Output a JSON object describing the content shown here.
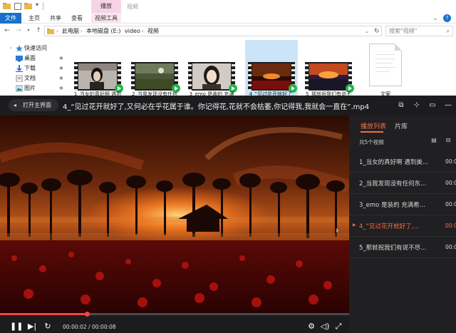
{
  "explorer": {
    "ribbon_context_tab": "播放",
    "window_title": "视频",
    "tabs": {
      "file": "文件",
      "home": "主页",
      "share": "共享",
      "view": "查看",
      "video_tools": "视频工具"
    },
    "breadcrumb": [
      "此电脑",
      "本地磁盘 (E:)",
      "video",
      "视频"
    ],
    "search_placeholder": "搜索\"视频\"",
    "nav_items": [
      {
        "label": "快速访问",
        "icon": "star-icon"
      },
      {
        "label": "桌面",
        "icon": "desktop-icon"
      },
      {
        "label": "下载",
        "icon": "download-icon"
      },
      {
        "label": "文档",
        "icon": "document-icon"
      },
      {
        "label": "图片",
        "icon": "picture-icon"
      }
    ],
    "files": [
      {
        "label": "1_当女的真好啊 遇到",
        "type": "video"
      },
      {
        "label": "2_当我发现没有任何",
        "type": "video"
      },
      {
        "label": "3_emo 是装的 充满",
        "type": "video"
      },
      {
        "label": "4_\"见过花开就好了,",
        "type": "video",
        "selected": true
      },
      {
        "label": "5_那就祝我们有说不",
        "type": "video"
      },
      {
        "label": "文案",
        "type": "text"
      }
    ]
  },
  "player": {
    "home_button": "打开主界面",
    "title": "4_“见过花开就好了,又何必在乎花属于谁。你记得花,花就不会枯萎,你记得我,我就会一直在”.mp4",
    "tabs": {
      "playlist": "播放列表",
      "library": "片库"
    },
    "count_text": "共5个视频",
    "items": [
      {
        "title": "1_当女的真好啊 遇到美...",
        "duration": "00:0"
      },
      {
        "title": "2_当我发现没有任何东...",
        "duration": "00:0"
      },
      {
        "title": "3_emo 是装的 充满希...",
        "duration": "00:0"
      },
      {
        "title": "4_“见过花开就好了,...",
        "duration": "00:0",
        "active": true
      },
      {
        "title": "5_那就祝我们有说不尽...",
        "duration": "00:0"
      }
    ],
    "time_current": "00:00:02",
    "time_sep": " / ",
    "time_total": "00:00:08",
    "progress_fraction": 0.25,
    "accent_color": "#ff6a3d"
  }
}
